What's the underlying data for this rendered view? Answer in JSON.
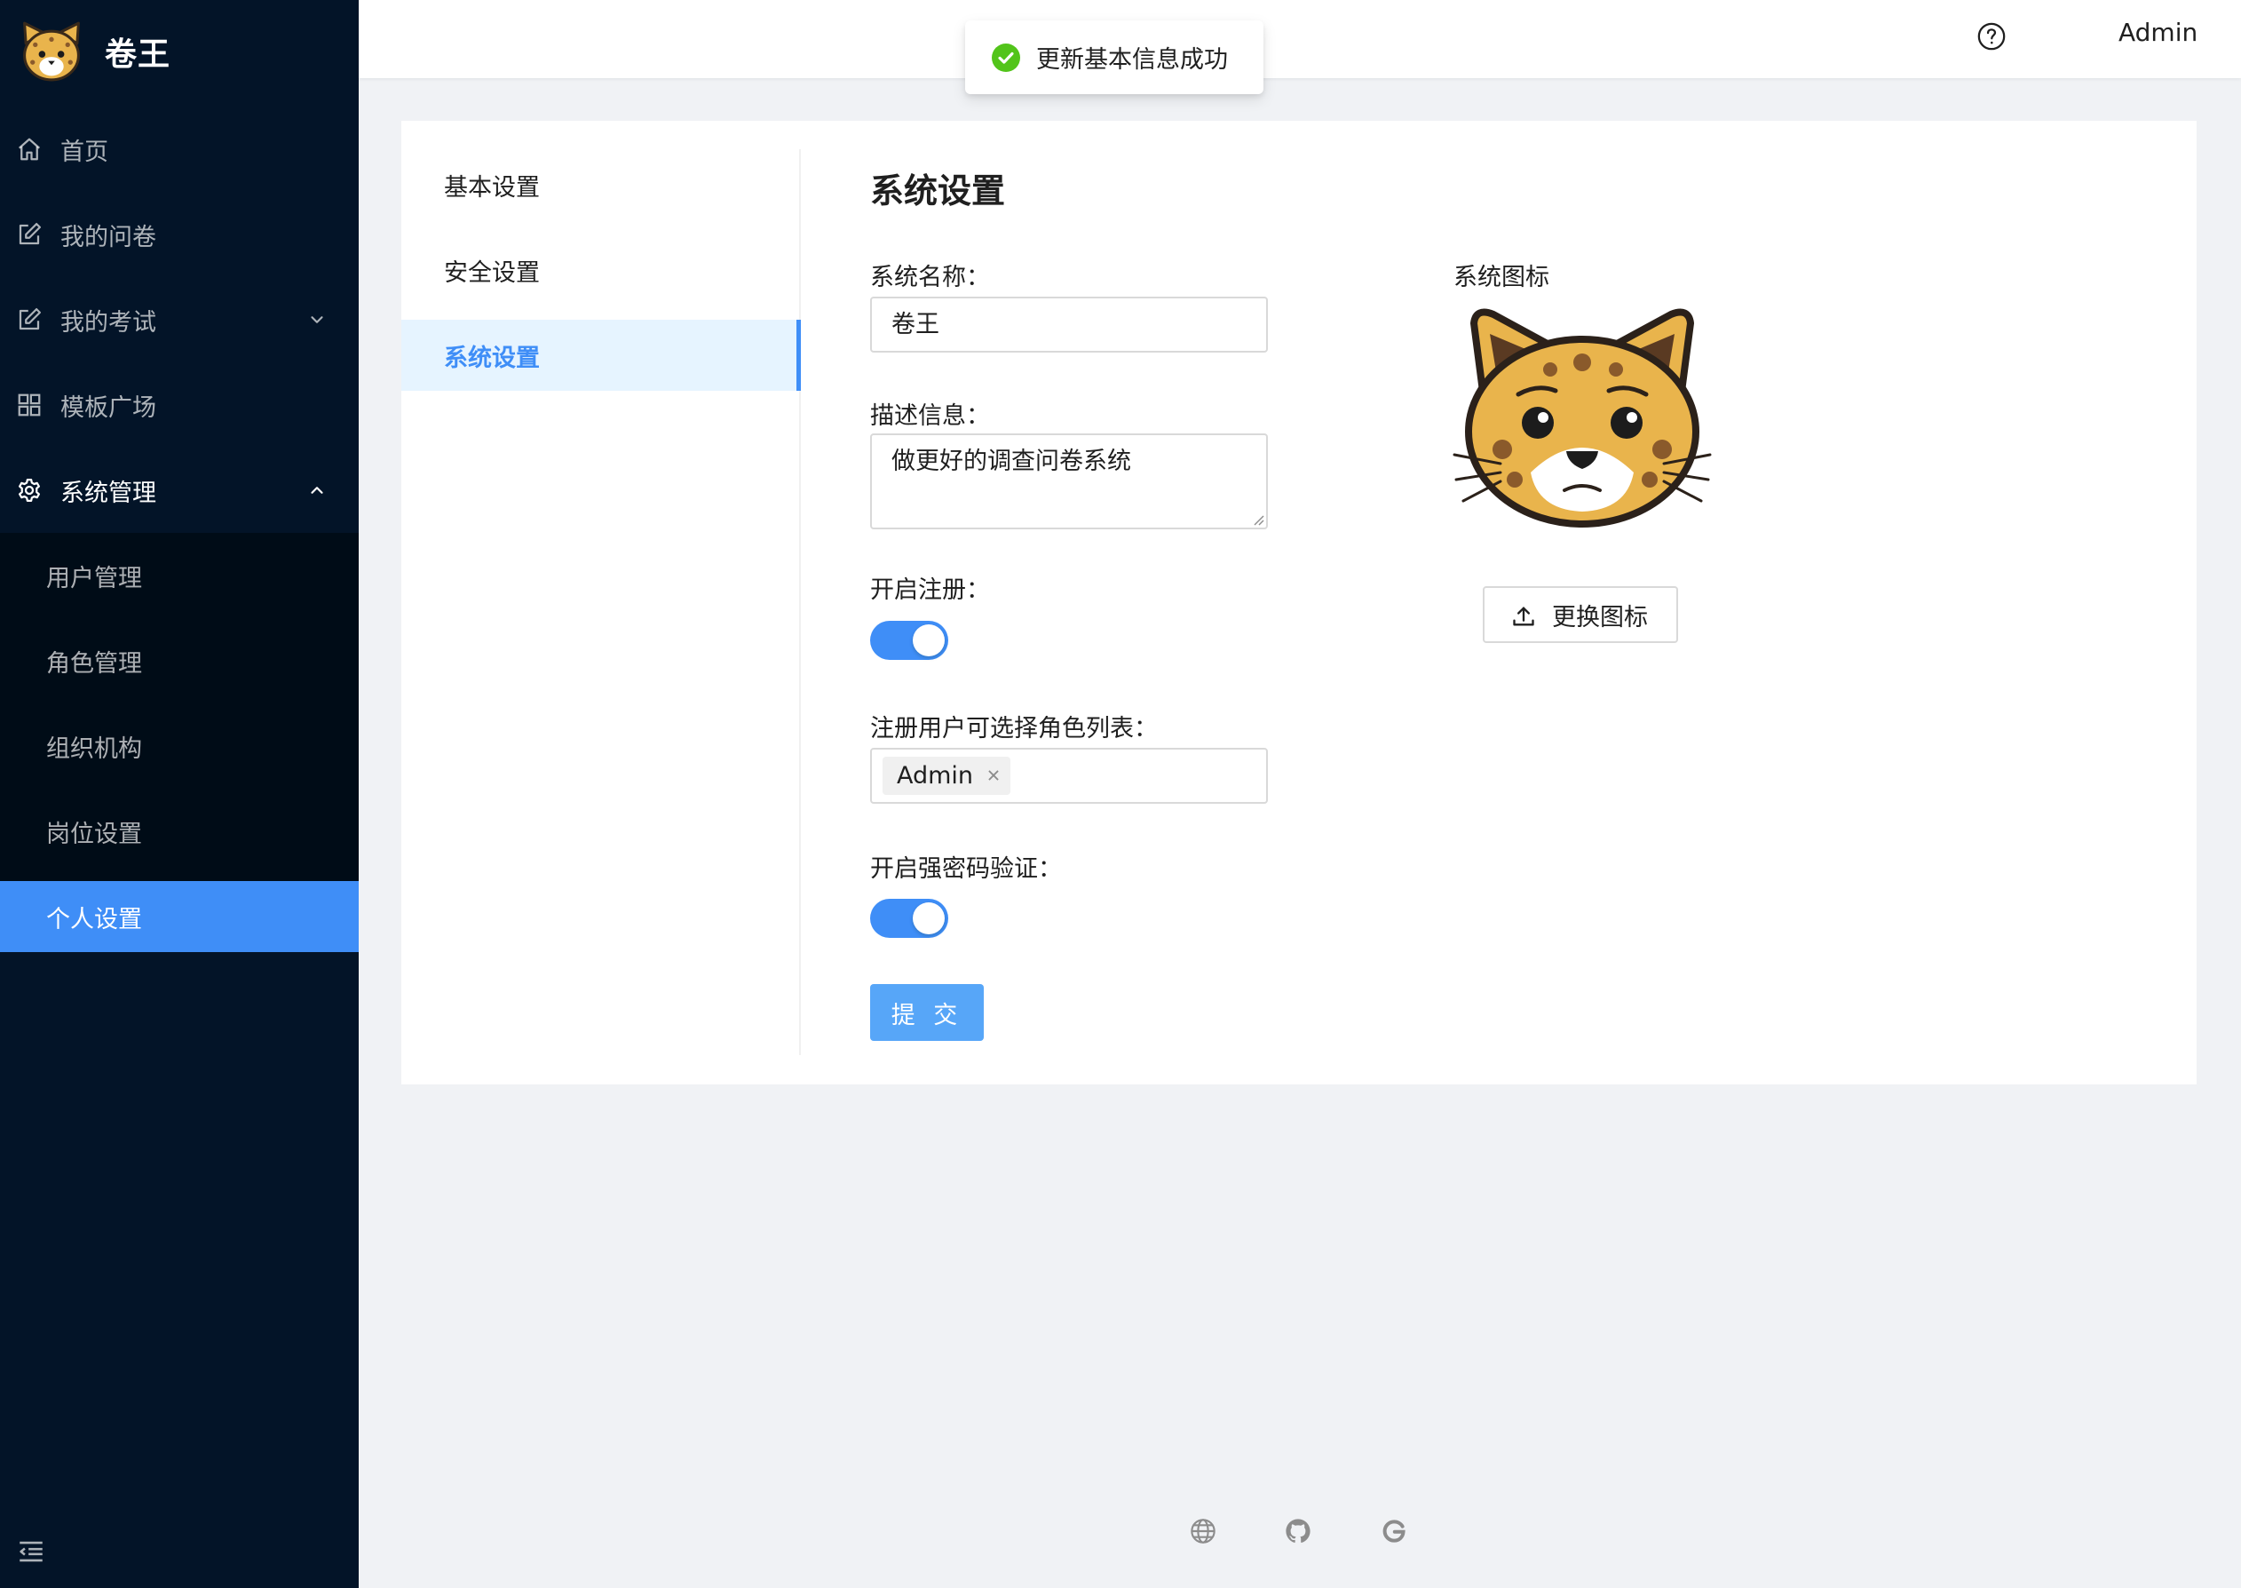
{
  "app": {
    "name": "卷王"
  },
  "sidebar": {
    "items": [
      {
        "label": "首页",
        "icon": "home-icon"
      },
      {
        "label": "我的问卷",
        "icon": "edit-icon"
      },
      {
        "label": "我的考试",
        "icon": "edit-icon",
        "expandable": true
      },
      {
        "label": "模板广场",
        "icon": "grid-icon"
      },
      {
        "label": "系统管理",
        "icon": "gear-icon",
        "expanded": true
      }
    ],
    "sub_items": [
      {
        "label": "用户管理"
      },
      {
        "label": "角色管理"
      },
      {
        "label": "组织机构"
      },
      {
        "label": "岗位设置"
      },
      {
        "label": "个人设置",
        "active": true
      }
    ]
  },
  "header": {
    "user": "Admin"
  },
  "toast": {
    "message": "更新基本信息成功",
    "type": "success"
  },
  "tabs": [
    {
      "label": "基本设置"
    },
    {
      "label": "安全设置"
    },
    {
      "label": "系统设置",
      "active": true
    }
  ],
  "form": {
    "title": "系统设置",
    "system_name_label": "系统名称",
    "system_name_value": "卷王",
    "description_label": "描述信息",
    "description_value": "做更好的调查问卷系统",
    "registration_label": "开启注册",
    "registration_enabled": true,
    "roles_label": "注册用户可选择角色列表",
    "roles": [
      "Admin"
    ],
    "strong_password_label": "开启强密码验证",
    "strong_password_enabled": true,
    "submit_label": "提 交",
    "icon_label": "系统图标",
    "change_icon_label": "更换图标"
  },
  "footer": {
    "icons": [
      "globe-icon",
      "github-icon",
      "google-icon"
    ]
  },
  "colors": {
    "sider_bg": "#031428",
    "primary": "#3f8ef7",
    "success": "#52c41a"
  }
}
